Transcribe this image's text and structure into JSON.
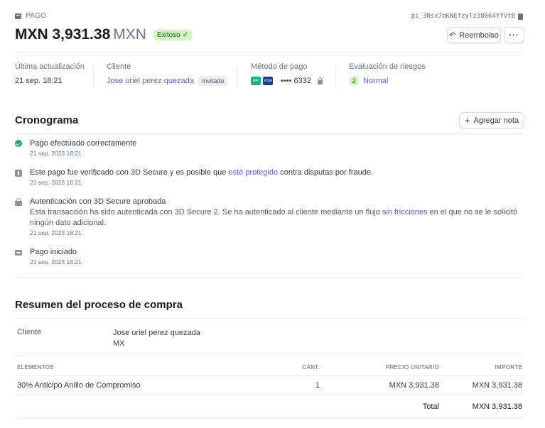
{
  "header": {
    "object_label": "PAGO",
    "payment_id": "pi_3Nsx7oKNEfzyTz38064YfVtB",
    "amount": "MXN 3,931.38",
    "currency": "MXN",
    "status": "Exitoso",
    "refund_label": "Reembolso",
    "more_label": "···"
  },
  "info": {
    "updated_label": "Última actualización",
    "updated_value": "21 sep. 18:21",
    "customer_label": "Cliente",
    "customer_name": "Jose uriel perez quezada",
    "customer_badge": "Invitado",
    "method_label": "Método de pago",
    "card_brand_1": "link",
    "card_brand_2": "VISA",
    "card_last4": "•••• 6332",
    "risk_label": "Evaluación de riesgos",
    "risk_score": "2",
    "risk_value": "Normal"
  },
  "timeline": {
    "title": "Cronograma",
    "add_note_label": "Agregar nota",
    "items": [
      {
        "icon": "check-circle-icon",
        "text": "Pago efectuado correctamente",
        "date": "21 sep. 2023 18:21"
      },
      {
        "icon": "info-icon",
        "text_before": "Este pago fue verificado con 3D Secure y es posible que ",
        "link": "esté protegido",
        "text_after": " contra disputas por fraude.",
        "date": "21 sep. 2023 18:21"
      },
      {
        "icon": "lock-icon",
        "text": "Autenticación con 3D Secure aprobada",
        "desc_before": "Esta transacción ha sido autenticada con 3D Secure 2. Se ha autenticado al cliente mediante un flujo ",
        "desc_link": "sin fricciones",
        "desc_after": " en el que no se le solicitó ningún dato adicional.",
        "date": "21 sep. 2023 18:21"
      },
      {
        "icon": "card-icon",
        "text": "Pago iniciado",
        "date": "21 sep. 2023 18:21"
      }
    ]
  },
  "checkout": {
    "title": "Resumen del proceso de compra",
    "customer_label": "Cliente",
    "customer_name": "Jose uriel perez quezada",
    "customer_country": "MX",
    "columns": {
      "items": "ELEMENTOS",
      "qty": "CANT.",
      "unit": "PRECIO UNITARIO",
      "amount": "IMPORTE"
    },
    "rows": [
      {
        "item": "30% Anticipo Anillo de Compromiso",
        "qty": "1",
        "unit": "MXN 3,931.38",
        "amount": "MXN 3,931.38"
      }
    ],
    "total_label": "Total",
    "total_value": "MXN 3,931.38"
  },
  "colors": {
    "accent": "#5e62d9",
    "success": "#1ea672",
    "success_bg": "#d7f7c2"
  }
}
